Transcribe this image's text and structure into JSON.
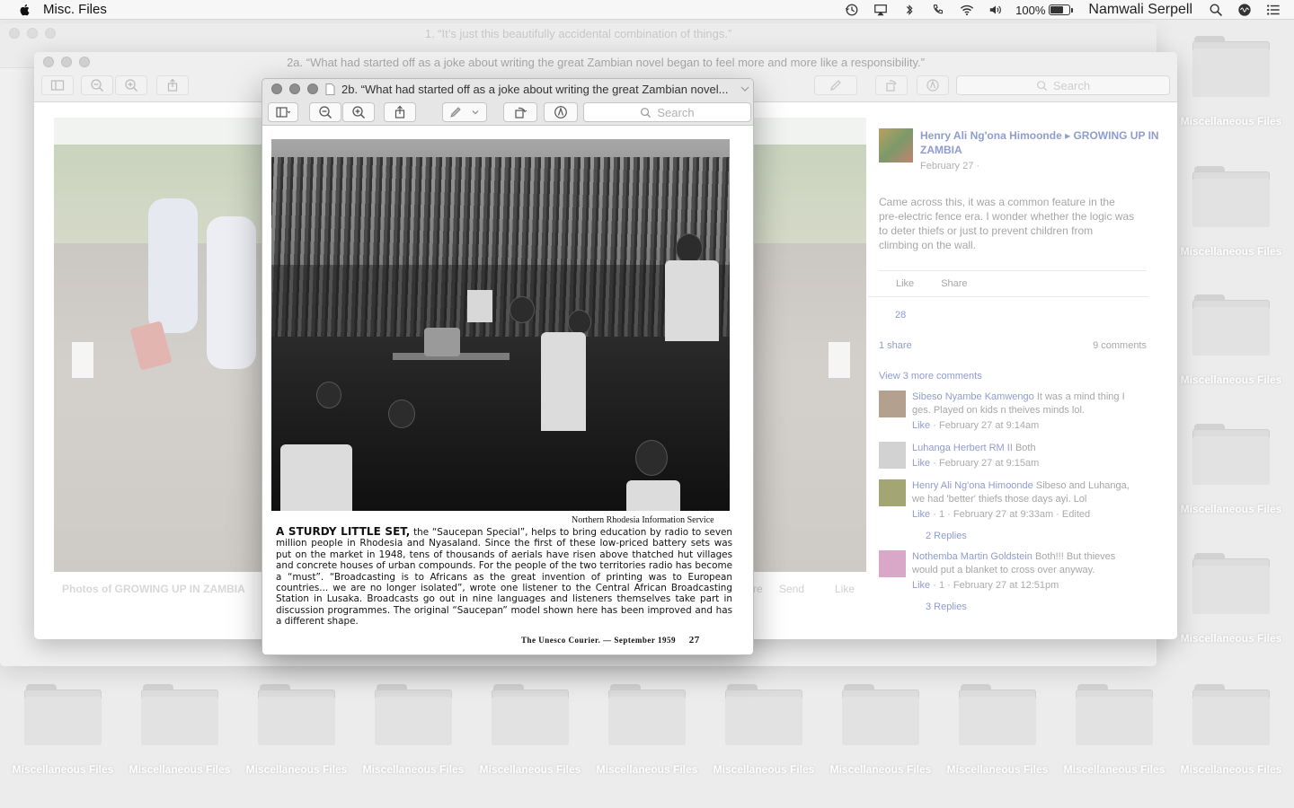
{
  "menubar": {
    "app_name": "Misc. Files",
    "battery_percent": "100%",
    "user_name": "Namwali Serpell"
  },
  "desktop": {
    "folder_label": "Miscellaneous Files"
  },
  "windows": {
    "back": {
      "title": "1. “It’s just this beautifully accidental combination of things.”"
    },
    "middle": {
      "title": "2a. “What had started off as a joke about writing the great Zambian novel began to feel more and more like a responsibility.”",
      "search_placeholder": "Search",
      "facebook": {
        "photos_caption": "Photos of GROWING UP IN ZAMBIA",
        "actions_left": "re",
        "action_send": "Send",
        "action_like": "Like",
        "post_author": "Henry Ali Ng'ona Himoonde",
        "post_group": "GROWING UP IN ZAMBIA",
        "post_date": "February 27 ·",
        "post_body": "Came across this, it was a common feature in the pre-electric fence era. I wonder whether the logic was to deter thiefs or just to prevent children from climbing on the wall.",
        "like_label": "Like",
        "share_label": "Share",
        "like_count": "28",
        "share_count": "1 share",
        "comments_count": "9 comments",
        "view_more": "View 3 more comments",
        "comments": [
          {
            "name": "Sibeso Nyambe Kamwengo",
            "text": "It was a mind thing I ges. Played on kids n theives minds lol.",
            "like": "Like",
            "meta": "· February 27 at 9:14am",
            "avatar_color": "#b3a08e"
          },
          {
            "name": "Luhanga Herbert RM II",
            "text": "Both",
            "like": "Like",
            "meta": "· February 27 at 9:15am",
            "avatar_color": "#d2d2d2"
          },
          {
            "name": "Henry Ali Ng'ona Himoonde",
            "text": "Sibeso and Luhanga, we had 'better' thiefs those days ayi. Lol",
            "like": "Like",
            "meta": "·     1 · February 27 at 9:33am · Edited",
            "avatar_color": "#a3a572",
            "replies": "2 Replies"
          },
          {
            "name": "Nothemba Martin Goldstein",
            "text": "Both!!! But thieves would put a blanket to cross over anyway.",
            "like": "Like",
            "meta": "·     1 · February 27 at 12:51pm",
            "avatar_color": "#d9a7c8",
            "replies": "3 Replies"
          }
        ]
      }
    },
    "front": {
      "title": "2b. “What had started off as a joke about writing the great Zambian novel...",
      "search_placeholder": "Search",
      "document": {
        "credit": "Northern Rhodesia Information Service",
        "headline": "A STURDY LITTLE SET,",
        "body": "the “Saucepan Special”, helps to bring education by radio to seven million people in Rhodesia and Nyasaland. Since the first of these low-priced battery sets was put on the market in 1948, tens of thousands of aerials have risen above thatched hut villages and concrete houses of urban compounds. For the people of the two territories radio has become a “must”. “Broadcasting is to Africans as the great invention of printing was to European countries... we are no longer isolated”, wrote one listener to the Central African Broadcasting Station in Lusaka. Broadcasts go out in nine languages and listeners themselves take part in discussion programmes. The original “Saucepan” model shown here has been improved and has a different shape.",
        "footer_source": "The  Unesco  Courier.  —  September  1959",
        "page_number": "27"
      }
    }
  },
  "colors": {
    "link": "#8f9ccf",
    "desktop": "#ececec"
  }
}
